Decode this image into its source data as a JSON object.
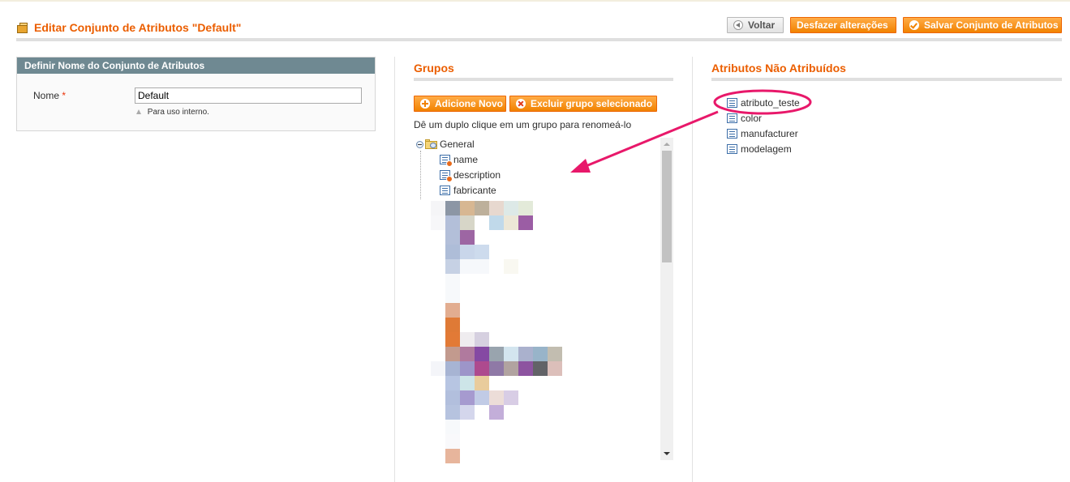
{
  "header": {
    "title": "Editar Conjunto de Atributos \"Default\"",
    "buttons": {
      "back": "Voltar",
      "reset": "Desfazer alterações",
      "save": "Salvar Conjunto de Atributos"
    }
  },
  "name_panel": {
    "heading": "Definir Nome do Conjunto de Atributos",
    "name_label": "Nome",
    "required_mark": "*",
    "name_value": "Default",
    "hint": "Para uso interno."
  },
  "groups": {
    "title": "Grupos",
    "add_button": "Adicione Novo",
    "delete_button": "Excluir grupo selecionado",
    "instruction": "Dê um duplo clique em um grupo para renomeá-lo",
    "tree": {
      "group_label": "General",
      "attributes": [
        {
          "label": "name",
          "system": true
        },
        {
          "label": "description",
          "system": true
        },
        {
          "label": "fabricante",
          "system": false
        }
      ]
    }
  },
  "unassigned": {
    "title": "Atributos Não Atribuídos",
    "items": [
      "atributo_teste",
      "color",
      "manufacturer",
      "modelagem"
    ],
    "highlighted_item": "atributo_teste"
  },
  "colors": {
    "accent": "#eb5e00",
    "button": "#f18200",
    "panel_header": "#6f8992",
    "annotation": "#e8186a"
  },
  "icons": [
    "folder-icon",
    "attribute-icon",
    "back-icon",
    "save-icon",
    "plus-icon",
    "delete-icon"
  ]
}
